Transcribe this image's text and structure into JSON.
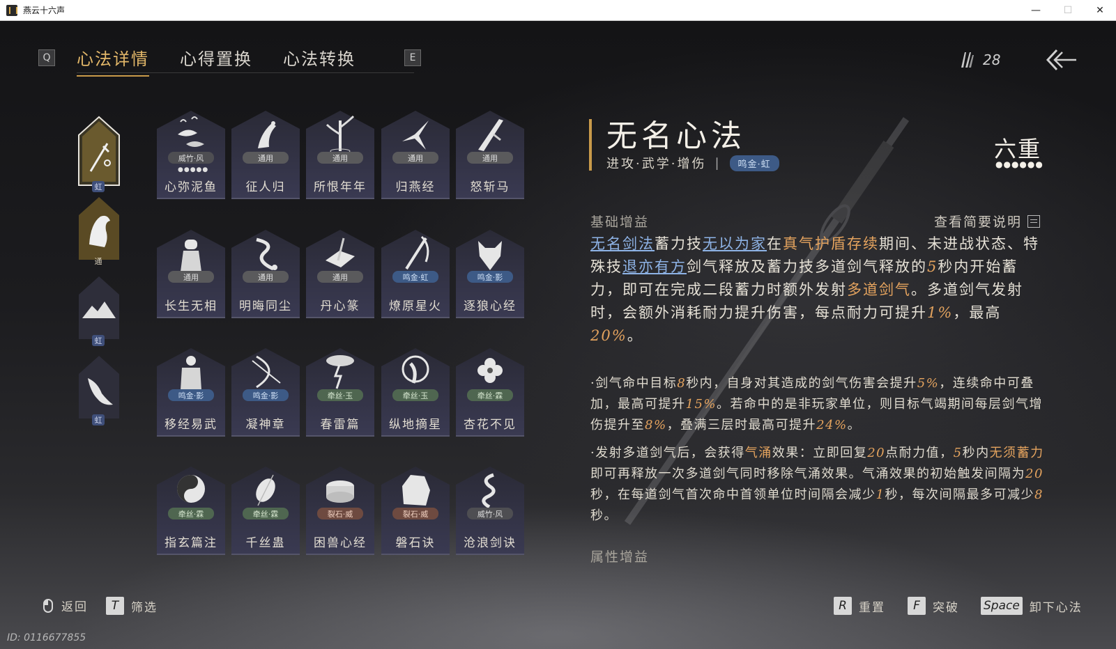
{
  "window": {
    "title": "燕云十六声",
    "minimize": "—",
    "maximize": "☐",
    "close": "✕"
  },
  "tabs": {
    "left_key": "Q",
    "right_key": "E",
    "items": [
      {
        "label": "心法详情",
        "active": true
      },
      {
        "label": "心得置换",
        "active": false
      },
      {
        "label": "心法转换",
        "active": false
      }
    ]
  },
  "currency": {
    "icon": "feather-icon",
    "count": "28"
  },
  "side_slots": [
    {
      "badge": "虹",
      "icon": "sword-icon"
    },
    {
      "badge": "通",
      "icon": "horse-icon"
    },
    {
      "badge": "虹",
      "icon": "mountain-icon"
    },
    {
      "badge": "虹",
      "icon": "bird-icon"
    }
  ],
  "cards": [
    {
      "name": "心弥泥鱼",
      "tag": "威竹·风",
      "tag_style": "grey",
      "dots": "●●●●●",
      "icon": "fish-icon"
    },
    {
      "name": "征人归",
      "tag": "通用",
      "tag_style": "tong",
      "dots": "",
      "icon": "crane-icon"
    },
    {
      "name": "所恨年年",
      "tag": "通用",
      "tag_style": "tong",
      "dots": "",
      "icon": "bamboo-icon"
    },
    {
      "name": "归燕经",
      "tag": "通用",
      "tag_style": "tong",
      "dots": "",
      "icon": "swallow-icon"
    },
    {
      "name": "怒斩马",
      "tag": "通用",
      "tag_style": "tong",
      "dots": "",
      "icon": "blade-icon"
    },
    {
      "name": "长生无相",
      "tag": "通用",
      "tag_style": "tong",
      "dots": "",
      "icon": "statue-icon"
    },
    {
      "name": "明晦同尘",
      "tag": "通用",
      "tag_style": "tong",
      "dots": "",
      "icon": "snake-icon"
    },
    {
      "name": "丹心篆",
      "tag": "通用",
      "tag_style": "tong",
      "dots": "",
      "icon": "book-icon"
    },
    {
      "name": "燎原星火",
      "tag": "鸣金·虹",
      "tag_style": "blue",
      "dots": "",
      "icon": "spear-icon"
    },
    {
      "name": "逐狼心经",
      "tag": "鸣金·影",
      "tag_style": "blue",
      "dots": "",
      "icon": "wolf-icon"
    },
    {
      "name": "移经易武",
      "tag": "鸣金·影",
      "tag_style": "blue",
      "dots": "",
      "icon": "armor-icon"
    },
    {
      "name": "凝神章",
      "tag": "鸣金·影",
      "tag_style": "blue",
      "dots": "",
      "icon": "bow-icon"
    },
    {
      "name": "春雷篇",
      "tag": "牵丝·玉",
      "tag_style": "green",
      "dots": "",
      "icon": "lightning-icon"
    },
    {
      "name": "纵地摘星",
      "tag": "牵丝·玉",
      "tag_style": "green",
      "dots": "",
      "icon": "dancer-icon"
    },
    {
      "name": "杏花不见",
      "tag": "牵丝·霖",
      "tag_style": "green",
      "dots": "",
      "icon": "flower-icon"
    },
    {
      "name": "指玄篇注",
      "tag": "牵丝·霖",
      "tag_style": "green",
      "dots": "",
      "icon": "taiji-icon"
    },
    {
      "name": "千丝蛊",
      "tag": "牵丝·霖",
      "tag_style": "green",
      "dots": "",
      "icon": "cocoon-icon"
    },
    {
      "name": "困兽心经",
      "tag": "裂石·威",
      "tag_style": "red",
      "dots": "",
      "icon": "drum-icon"
    },
    {
      "name": "磐石诀",
      "tag": "裂石·威",
      "tag_style": "red",
      "dots": "",
      "icon": "rock-icon"
    },
    {
      "name": "沧浪剑诀",
      "tag": "威竹·风",
      "tag_style": "grey",
      "dots": "",
      "icon": "dragon-icon"
    }
  ],
  "detail": {
    "title": "无名心法",
    "tags": "进攻·武学·增伤",
    "separator": "|",
    "badge": "鸣金·虹",
    "level": "六重",
    "level_dots": "●●●●●●",
    "section_base": "基础增益",
    "brief_link": "查看简要说明",
    "main": {
      "p1": "无名剑法",
      "p2": "蓄力技",
      "p3": "无以为家",
      "p4": "在",
      "p5": "真气护盾存续",
      "p6": "期间、未进战状态、特殊技",
      "p7": "退亦有方",
      "p8": "剑气释放及蓄力技多道剑气释放的",
      "p9": "5",
      "p10": "秒内开始蓄力，即可在完成二段蓄力时额外发射",
      "p11": "多道剑气",
      "p12": "。多道剑气发射时，会额外消耗耐力提升伤害，每点耐力可提升",
      "p13": "1%",
      "p14": "，最高",
      "p15": "20%",
      "p16": "。"
    },
    "sub1": {
      "a": "·剑气命中目标",
      "b": "8",
      "c": "秒内，自身对其造成的剑气伤害会提升",
      "d": "5%",
      "e": "，连续命中可叠加，最高可提升",
      "f": "15%",
      "g": "。若命中的是非玩家单位，则目标气竭期间每层剑气增伤提升至",
      "h": "8%",
      "i": "，叠满三层时最高可提升",
      "j": "24%",
      "k": "。"
    },
    "sub2": {
      "a": "·发射多道剑气后，会获得",
      "b": "气涌",
      "c": "效果：立即回复",
      "d": "20",
      "e": "点耐力值，",
      "f": "5",
      "g": "秒内",
      "h": "无须蓄力",
      "i": "即可再释放一次多道剑气同时移除气涌效果。气涌效果的初始触发间隔为",
      "j": "20",
      "k": "秒，在每道剑气首次命中首领单位时间隔会减少",
      "l": "1",
      "m": "秒，每次间隔最多可减少",
      "n": "8",
      "o": "秒。"
    },
    "section_attr": "属性增益"
  },
  "footer": {
    "back_label": "返回",
    "filter_key": "T",
    "filter_label": "筛选",
    "reset_key": "R",
    "reset_label": "重置",
    "break_key": "F",
    "break_label": "突破",
    "unload_key": "Space",
    "unload_label": "卸下心法"
  },
  "uid": "ID: 0116677855",
  "colors": {
    "accent": "#c89a4a",
    "highlight": "#e4a35e",
    "link": "#8eb3e6",
    "card_bg": "#33334a"
  }
}
